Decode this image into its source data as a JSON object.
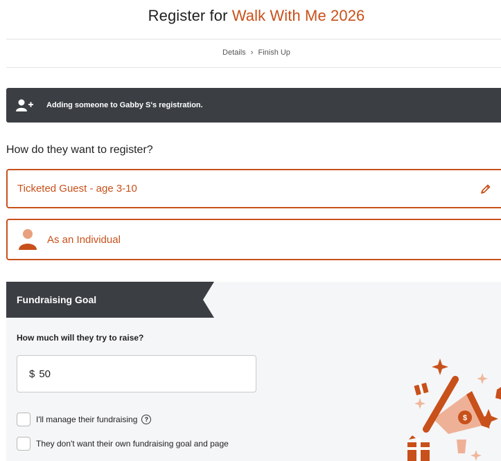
{
  "header": {
    "title_prefix": "Register for",
    "event_name": "Walk With Me 2026"
  },
  "breadcrumb": {
    "step1": "Details",
    "separator": "›",
    "step2": "Finish Up"
  },
  "banner": {
    "icon": "add-user-icon",
    "message": "Adding someone to Gabby S's registration."
  },
  "registration": {
    "question": "How do they want to register?",
    "ticket_type": "Ticketed Guest - age 3-10",
    "edit_icon": "pencil-icon",
    "participation": "As an Individual",
    "participation_icon": "person-icon"
  },
  "fundraising": {
    "tab_label": "Fundraising Goal",
    "question": "How much will they try to raise?",
    "currency": "$",
    "amount": "50",
    "manage_label": "I'll manage their fundraising",
    "help_symbol": "?",
    "no_goal_label": "They don't want their own fundraising goal and page",
    "manage_checked": false,
    "no_goal_checked": false
  },
  "colors": {
    "accent": "#c8501a",
    "dark": "#3b3f44",
    "panel": "#f5f6f8"
  }
}
